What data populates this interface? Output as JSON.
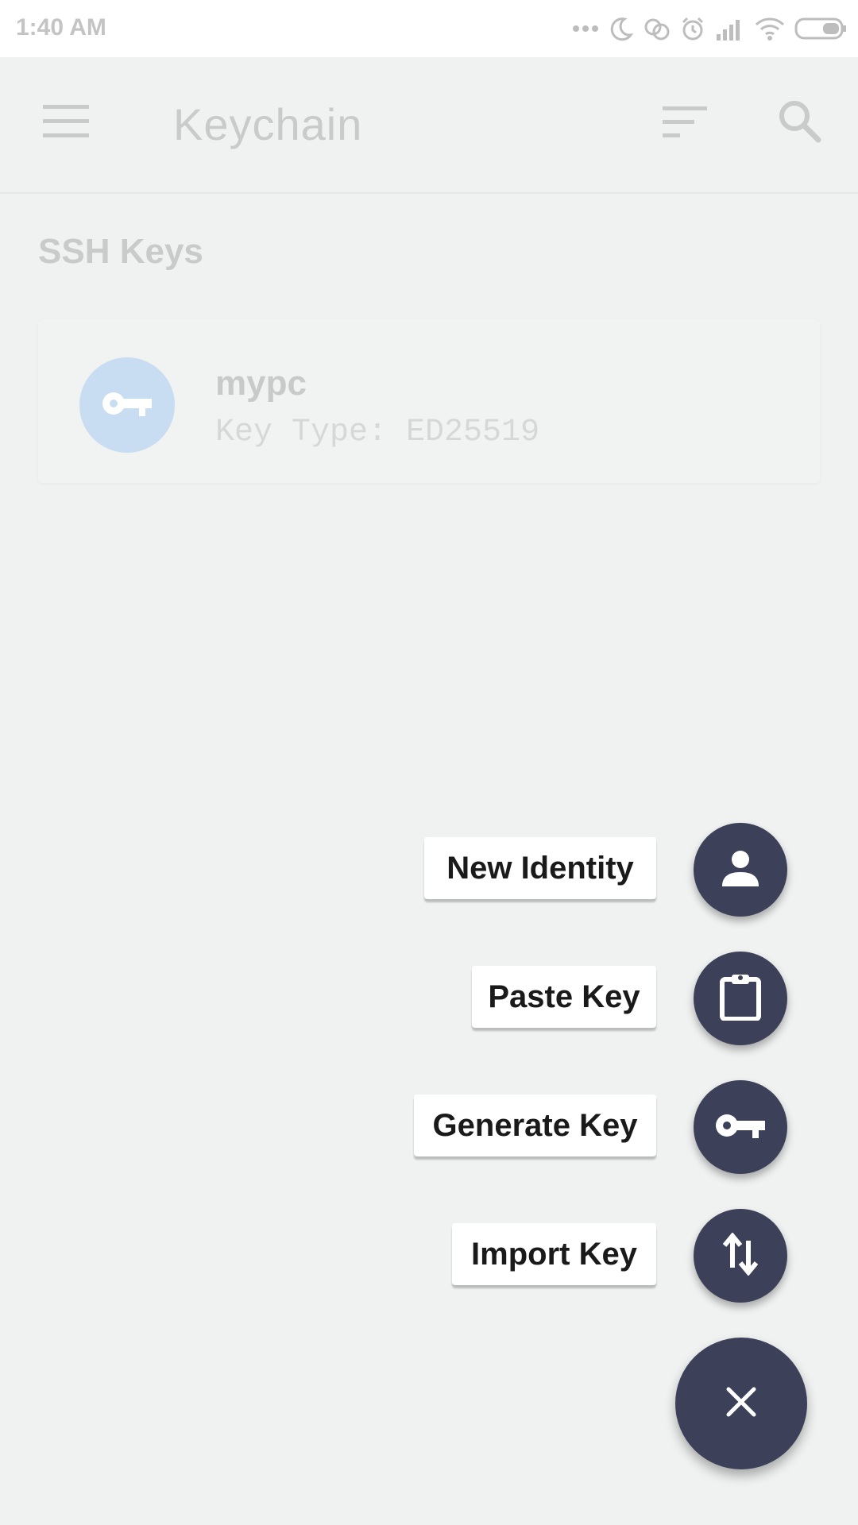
{
  "status_bar": {
    "time": "1:40 AM"
  },
  "app_bar": {
    "title": "Keychain"
  },
  "section": {
    "title": "SSH Keys"
  },
  "keys": [
    {
      "name": "mypc",
      "meta": "Key Type: ED25519"
    }
  ],
  "fab_menu": {
    "new_identity": "New Identity",
    "paste_key": "Paste Key",
    "generate_key": "Generate Key",
    "import_key": "Import Key"
  },
  "colors": {
    "fab": "#3c4058",
    "avatar": "#c8dcf2",
    "background": "#f0f1f1"
  }
}
